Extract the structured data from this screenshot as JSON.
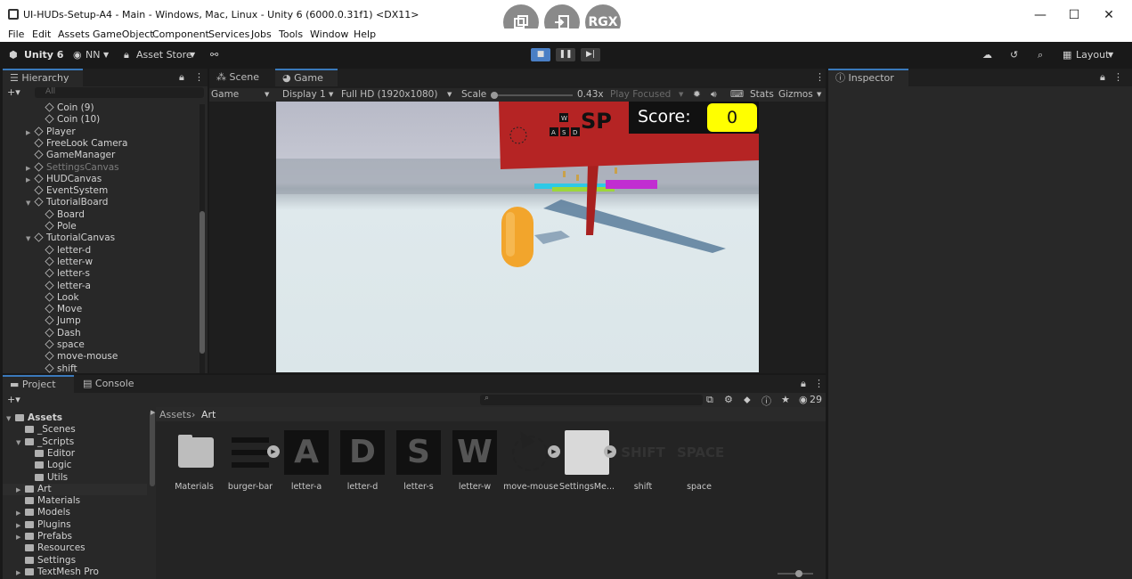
{
  "window": {
    "title": "UI-HUDs-Setup-A4 - Main - Windows, Mac, Linux - Unity 6 (6000.0.31f1) <DX11>",
    "minimize": "—",
    "maximize": "☐",
    "close": "✕"
  },
  "recorder": {
    "btn3_label": "RGX"
  },
  "menu": [
    "File",
    "Edit",
    "Assets",
    "GameObject",
    "Component",
    "Services",
    "Jobs",
    "Tools",
    "Window",
    "Help"
  ],
  "toolbar": {
    "unity_label": "Unity 6",
    "account_label": "NN",
    "asset_store_label": "Asset Store",
    "layout_label": "Layout"
  },
  "hierarchy": {
    "tab_label": "Hierarchy",
    "search_placeholder": "All",
    "items": [
      {
        "label": "Coin (9)",
        "indent": 2,
        "arrow": "",
        "dim": false
      },
      {
        "label": "Coin (10)",
        "indent": 2,
        "arrow": "",
        "dim": false
      },
      {
        "label": "Player",
        "indent": 1,
        "arrow": "▶",
        "dim": false
      },
      {
        "label": "FreeLook Camera",
        "indent": 1,
        "arrow": "",
        "dim": false
      },
      {
        "label": "GameManager",
        "indent": 1,
        "arrow": "",
        "dim": false
      },
      {
        "label": "SettingsCanvas",
        "indent": 1,
        "arrow": "▶",
        "dim": true
      },
      {
        "label": "HUDCanvas",
        "indent": 1,
        "arrow": "▶",
        "dim": false
      },
      {
        "label": "EventSystem",
        "indent": 1,
        "arrow": "",
        "dim": false
      },
      {
        "label": "TutorialBoard",
        "indent": 1,
        "arrow": "▼",
        "dim": false
      },
      {
        "label": "Board",
        "indent": 2,
        "arrow": "",
        "dim": false
      },
      {
        "label": "Pole",
        "indent": 2,
        "arrow": "",
        "dim": false
      },
      {
        "label": "TutorialCanvas",
        "indent": 1,
        "arrow": "▼",
        "dim": false
      },
      {
        "label": "letter-d",
        "indent": 2,
        "arrow": "",
        "dim": false
      },
      {
        "label": "letter-w",
        "indent": 2,
        "arrow": "",
        "dim": false
      },
      {
        "label": "letter-s",
        "indent": 2,
        "arrow": "",
        "dim": false
      },
      {
        "label": "letter-a",
        "indent": 2,
        "arrow": "",
        "dim": false
      },
      {
        "label": "Look",
        "indent": 2,
        "arrow": "",
        "dim": false
      },
      {
        "label": "Move",
        "indent": 2,
        "arrow": "",
        "dim": false
      },
      {
        "label": "Jump",
        "indent": 2,
        "arrow": "",
        "dim": false
      },
      {
        "label": "Dash",
        "indent": 2,
        "arrow": "",
        "dim": false
      },
      {
        "label": "space",
        "indent": 2,
        "arrow": "",
        "dim": false
      },
      {
        "label": "move-mouse",
        "indent": 2,
        "arrow": "",
        "dim": false
      },
      {
        "label": "shift",
        "indent": 2,
        "arrow": "",
        "dim": false
      }
    ]
  },
  "gameview": {
    "tabs": [
      "Scene",
      "Game"
    ],
    "view_dropdown": "Game",
    "display_dropdown": "Display 1",
    "resolution_dropdown": "Full HD (1920x1080)",
    "scale_label": "Scale",
    "scale_value": "0.43x",
    "play_focused": "Play Focused",
    "stats_label": "Stats",
    "gizmos_label": "Gizmos",
    "hud": {
      "score_label": "Score:",
      "score_value": "0"
    },
    "board_keys": [
      "W",
      "A",
      "S",
      "D"
    ],
    "board_text_partial": "SP"
  },
  "inspector": {
    "tab_label": "Inspector"
  },
  "project": {
    "tabs": [
      "Project",
      "Console"
    ],
    "count_label": "29",
    "breadcrumb": [
      "Assets",
      "Art"
    ],
    "tree": [
      {
        "label": "Assets",
        "indent": 0,
        "arrow": "▼",
        "bold": true
      },
      {
        "label": "_Scenes",
        "indent": 1,
        "arrow": ""
      },
      {
        "label": "_Scripts",
        "indent": 1,
        "arrow": "▼"
      },
      {
        "label": "Editor",
        "indent": 2,
        "arrow": ""
      },
      {
        "label": "Logic",
        "indent": 2,
        "arrow": ""
      },
      {
        "label": "Utils",
        "indent": 2,
        "arrow": ""
      },
      {
        "label": "Art",
        "indent": 1,
        "arrow": "▶",
        "selected": true
      },
      {
        "label": "Materials",
        "indent": 1,
        "arrow": ""
      },
      {
        "label": "Models",
        "indent": 1,
        "arrow": "▶"
      },
      {
        "label": "Plugins",
        "indent": 1,
        "arrow": "▶"
      },
      {
        "label": "Prefabs",
        "indent": 1,
        "arrow": "▶"
      },
      {
        "label": "Resources",
        "indent": 1,
        "arrow": ""
      },
      {
        "label": "Settings",
        "indent": 1,
        "arrow": ""
      },
      {
        "label": "TextMesh Pro",
        "indent": 1,
        "arrow": "▶"
      }
    ],
    "assets": [
      {
        "label": "Materials",
        "kind": "folder",
        "glyph": ""
      },
      {
        "label": "burger-bar",
        "kind": "burger",
        "glyph": ""
      },
      {
        "label": "letter-a",
        "kind": "letter",
        "glyph": "A"
      },
      {
        "label": "letter-d",
        "kind": "letter",
        "glyph": "D"
      },
      {
        "label": "letter-s",
        "kind": "letter",
        "glyph": "S"
      },
      {
        "label": "letter-w",
        "kind": "letter",
        "glyph": "W"
      },
      {
        "label": "move-mouse",
        "kind": "mouse",
        "glyph": ""
      },
      {
        "label": "SettingsMe...",
        "kind": "blank",
        "glyph": ""
      },
      {
        "label": "shift",
        "kind": "word",
        "glyph": "SHIFT"
      },
      {
        "label": "space",
        "kind": "word",
        "glyph": "SPACE"
      }
    ]
  },
  "colors": {
    "score_bg": "#ffff00",
    "board": "#b52424",
    "player": "#f2a52c",
    "accent": "#3a79bb"
  }
}
